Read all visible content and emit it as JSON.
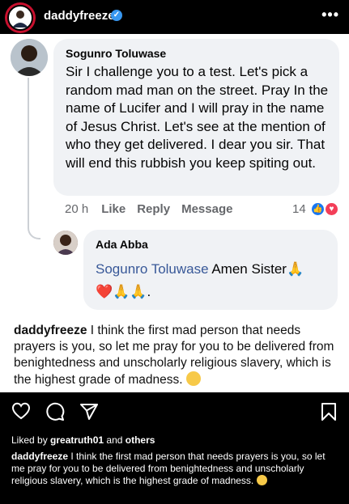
{
  "header": {
    "username": "daddyfreeze",
    "verified_icon": "verified-badge-icon",
    "more_icon": "more-options-icon"
  },
  "post_image": {
    "comment1": {
      "author": "Sogunro Toluwase",
      "text": "Sir I challenge you to a test. Let's pick a random mad man on the street. Pray In the name of Lucifer and I will pray in the name of Jesus Christ. Let's see at the mention of who they get delivered. I dear you sir. That will end this rubbish you keep spiting out.",
      "time": "20 h",
      "like_label": "Like",
      "reply_label": "Reply",
      "message_label": "Message",
      "reaction_count": "14"
    },
    "comment2": {
      "author": "Ada Abba",
      "tag": "Sogunro Toluwase",
      "text": " Amen Sister",
      "trailing": "."
    },
    "overlay_caption": {
      "username": "daddyfreeze",
      "text": " I think the first mad person that needs prayers is you, so let me pray for you to be delivered from benightedness and unscholarly religious slavery, which is the highest grade of madness."
    }
  },
  "likes": {
    "prefix": "Liked by ",
    "user": "greatruth01",
    "middle": " and ",
    "others": "others"
  },
  "caption": {
    "username": "daddyfreeze",
    "text": " I think the first mad person that needs prayers is you, so let me pray for you to be delivered from benightedness and unscholarly religious slavery, which is the highest grade of madness."
  },
  "colors": {
    "link": "#385898",
    "facebook_blue": "#1877f2",
    "love_red": "#f33e58",
    "bubble_bg": "#f0f2f5"
  }
}
